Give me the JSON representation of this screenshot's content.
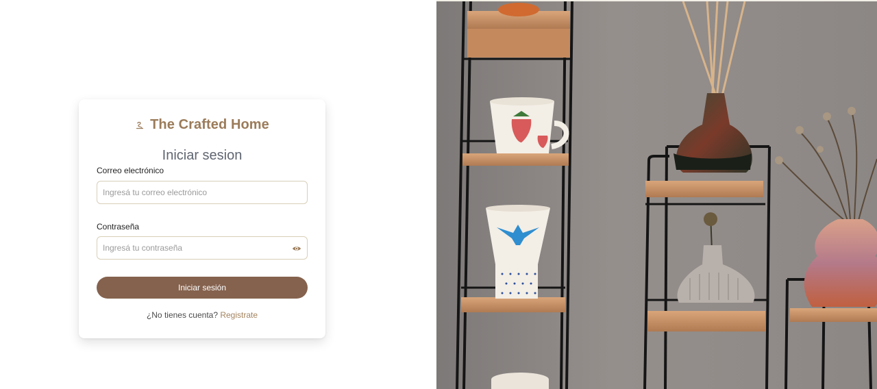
{
  "brand": {
    "name": "The Crafted Home",
    "icon": "swirl-logo-icon",
    "color": "#9b7b59"
  },
  "login": {
    "title": "Iniciar sesion",
    "email_label": "Correo electrónico",
    "email_placeholder": "Ingresá tu correo electrónico",
    "email_value": "",
    "password_label": "Contraseña",
    "password_placeholder": "Ingresá tu contraseña",
    "password_value": "",
    "password_toggle_icon": "eye-icon",
    "submit_label": "Iniciar sesión",
    "signup_prompt": "¿No tienes cuenta?",
    "signup_link": "Registrate"
  },
  "colors": {
    "accent": "#85624e",
    "link": "#a4835e",
    "input_border": "#d8cfb8",
    "wall": "#8f8b89"
  },
  "hero": {
    "subject": "Wall shelves with ceramic mugs, a reed diffuser and vases"
  }
}
